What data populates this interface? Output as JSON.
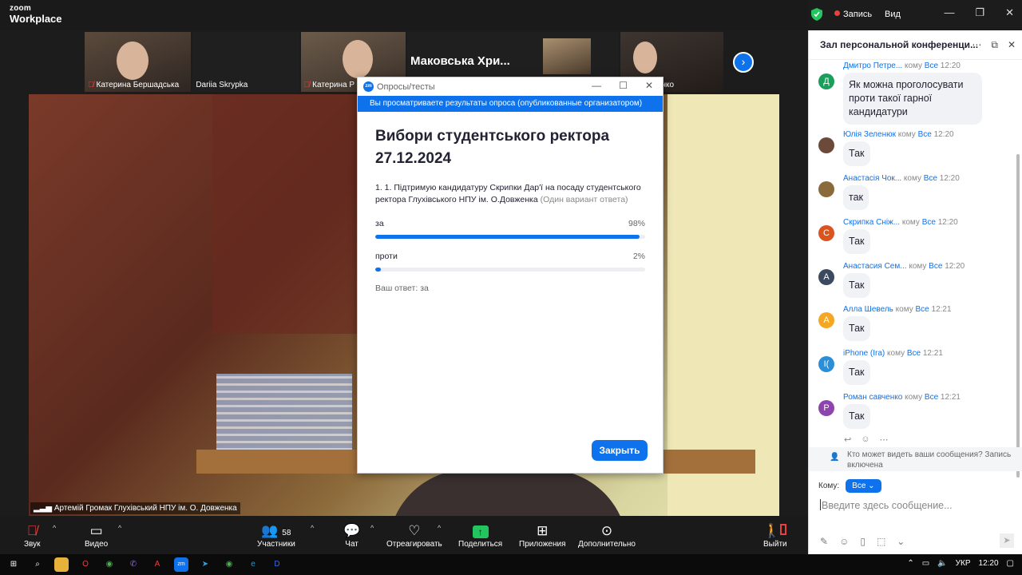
{
  "app": {
    "logo_line1": "zoom",
    "logo_line2": "Workplace",
    "recording_label": "Запись",
    "view_label": "Вид",
    "accent_color": "#0e72ed"
  },
  "thumbnails": [
    {
      "name": "Катерина Бершадська",
      "muted": true
    },
    {
      "name": "Dariia Skrypka",
      "muted": false
    },
    {
      "name": "Катерина Р",
      "muted": true
    },
    {
      "name": "Маковська  Хри...",
      "muted": false
    },
    {
      "name": "а Маринченко",
      "muted": false
    }
  ],
  "main_video": {
    "speaker_name": "Артемій Громак Глухівський НПУ ім. О. Довженка"
  },
  "poll": {
    "window_title": "Опросы/тесты",
    "banner": "Вы просматриваете результаты опроса (опубликованные организатором)",
    "heading": "Вибори студентського ректора 27.12.2024",
    "question": "1. 1. Підтримую кандидатуру Скрипки Дар'ї на посаду студентського ректора Глухівського НПУ ім. О.Довженка",
    "question_hint": "(Один вариант ответа)",
    "options": [
      {
        "label": "за",
        "percent_text": "98%",
        "fraction": 0.98
      },
      {
        "label": "проти",
        "percent_text": "2%",
        "fraction": 0.02
      }
    ],
    "your_answer": "Ваш ответ: за",
    "close_label": "Закрыть"
  },
  "chat": {
    "title": "Зал персональной конференци...",
    "messages": [
      {
        "sender": "Дмитро Петре...",
        "to": "кому",
        "audience": "Все",
        "time": "12:20",
        "initial": "Д",
        "color": "#1a9e5a",
        "text": "Як можна проголосувати проти такої гарної кандидатури"
      },
      {
        "sender": "Юлія Зеленюк",
        "to": "кому",
        "audience": "Все",
        "time": "12:20",
        "initial": "",
        "color": "#6b4a3a",
        "text": "Так"
      },
      {
        "sender": "Анастасія Чок...",
        "to": "кому",
        "audience": "Все",
        "time": "12:20",
        "initial": "",
        "color": "#8a6a3a",
        "text": "так"
      },
      {
        "sender": "Скрипка Сніж...",
        "to": "кому",
        "audience": "Все",
        "time": "12:20",
        "initial": "С",
        "color": "#d9541e",
        "text": "Так"
      },
      {
        "sender": "Анастасия Сем...",
        "to": "кому",
        "audience": "Все",
        "time": "12:20",
        "initial": "А",
        "color": "#3b4a5e",
        "text": "Так"
      },
      {
        "sender": "Алла Шевель",
        "to": "кому",
        "audience": "Все",
        "time": "12:21",
        "initial": "А",
        "color": "#f5a623",
        "text": "Так"
      },
      {
        "sender": "iPhone (Ira)",
        "to": "кому",
        "audience": "Все",
        "time": "12:21",
        "initial": "I(",
        "color": "#2b8ed6",
        "text": "Так"
      },
      {
        "sender": "Роман савченко",
        "to": "кому",
        "audience": "Все",
        "time": "12:21",
        "initial": "Р",
        "color": "#8e44ad",
        "text": "Так"
      }
    ],
    "note": "Кто может видеть ваши сообщения? Запись включена",
    "to_label": "Кому:",
    "to_value": "Все",
    "input_placeholder": "Введите здесь сообщение..."
  },
  "toolbar": {
    "audio": "Звук",
    "video": "Видео",
    "participants": "Участники",
    "participants_count": "58",
    "chat": "Чат",
    "react": "Отреагировать",
    "share": "Поделиться",
    "apps": "Приложения",
    "more": "Дополнительно",
    "leave": "Выйти"
  },
  "taskbar": {
    "lang": "УКР",
    "time": "12:20"
  }
}
